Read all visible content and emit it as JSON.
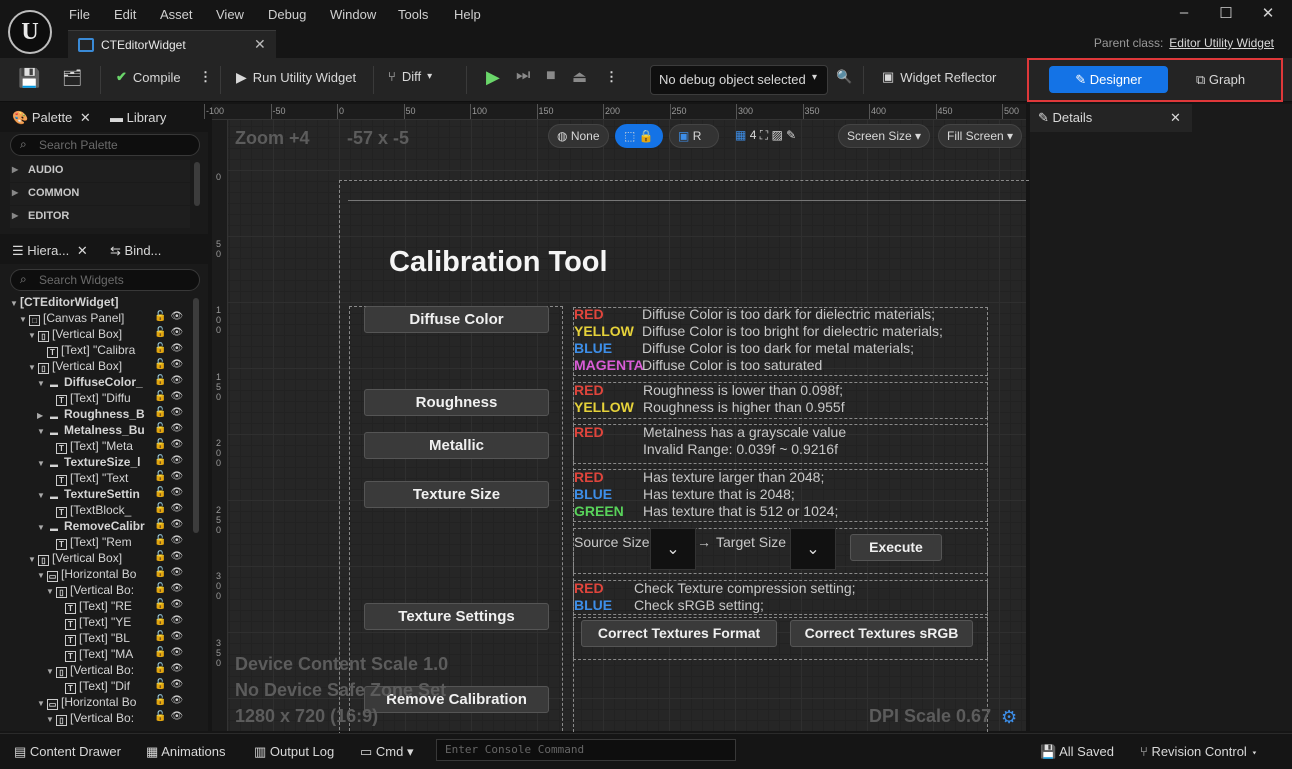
{
  "menu": [
    "File",
    "Edit",
    "Asset",
    "View",
    "Debug",
    "Window",
    "Tools",
    "Help"
  ],
  "tab": {
    "title": "CTEditorWidget"
  },
  "parent_class": {
    "label": "Parent class:",
    "value": "Editor Utility Widget"
  },
  "toolbar": {
    "compile": "Compile",
    "run": "Run Utility Widget",
    "diff": "Diff",
    "debug_object": "No debug object selected",
    "widget_reflector": "Widget Reflector",
    "designer": "Designer",
    "graph": "Graph"
  },
  "palette": {
    "tab": "Palette",
    "library_tab": "Library",
    "search_placeholder": "Search Palette",
    "categories": [
      "AUDIO",
      "COMMON",
      "EDITOR"
    ]
  },
  "hierarchy": {
    "tab": "Hiera...",
    "bind_tab": "Bind...",
    "search_placeholder": "Search Widgets",
    "rows": [
      "[CTEditorWidget]",
      "[Canvas Panel]",
      "[Vertical Box]",
      "[Text] \"Calibra",
      "[Vertical Box]",
      "DiffuseColor_",
      "[Text] \"Diffu",
      "Roughness_B",
      "Metalness_Bu",
      "[Text] \"Meta",
      "TextureSize_l",
      "[Text] \"Text",
      "TextureSettin",
      "[TextBlock_",
      "RemoveCalibr",
      "[Text] \"Rem",
      "[Vertical Box]",
      "[Horizontal Bo",
      "[Vertical Bo:",
      "[Text] \"RE",
      "[Text] \"YE",
      "[Text] \"BL",
      "[Text] \"MA",
      "[Vertical Bo:",
      "[Text] \"Dif",
      "[Horizontal Bo",
      "[Vertical Bo:"
    ]
  },
  "viewport": {
    "zoom": "Zoom +4",
    "coords": "-57 x -5",
    "none_btn": "None",
    "r_btn": "R",
    "grid_num": "4",
    "screen_size": "Screen Size",
    "fill_screen": "Fill Screen",
    "device_scale": "Device Content Scale 1.0",
    "safe_zone": "No Device Safe Zone Set",
    "resolution": "1280 x 720 (16:9)",
    "dpi": "DPI Scale 0.67",
    "ruler_top": [
      "-100",
      "-50",
      "0",
      "50",
      "100",
      "150",
      "200",
      "250",
      "300",
      "350",
      "400",
      "450",
      "500"
    ],
    "ruler_left": [
      [
        "0"
      ],
      [
        "5",
        "0"
      ],
      [
        "1",
        "0",
        "0"
      ],
      [
        "1",
        "5",
        "0"
      ],
      [
        "2",
        "0",
        "0"
      ],
      [
        "2",
        "5",
        "0"
      ],
      [
        "3",
        "0",
        "0"
      ],
      [
        "3",
        "5",
        "0"
      ]
    ]
  },
  "widget": {
    "title": "Calibration Tool",
    "buttons": {
      "diffuse": "Diffuse Color",
      "roughness": "Roughness",
      "metallic": "Metallic",
      "texture_size": "Texture Size",
      "texture_settings": "Texture Settings",
      "remove": "Remove Calibration"
    },
    "diffuse": {
      "labels": [
        "RED",
        "YELLOW",
        "BLUE",
        "MAGENTA"
      ],
      "desc": [
        "Diffuse Color is too dark for dielectric materials;",
        "Diffuse Color is too bright for dielectric materials;",
        "Diffuse Color is too dark for metal materials;",
        "Diffuse Color is too saturated"
      ]
    },
    "roughness": {
      "labels": [
        "RED",
        "YELLOW"
      ],
      "desc": [
        "Roughness is lower than 0.098f;",
        "Roughness is higher than 0.955f"
      ]
    },
    "metallic": {
      "labels": [
        "RED"
      ],
      "desc": [
        "Metalness has a grayscale value",
        "Invalid Range: 0.039f ~ 0.9216f"
      ]
    },
    "texsize": {
      "labels": [
        "RED",
        "BLUE",
        "GREEN"
      ],
      "desc": [
        "Has texture larger than 2048;",
        "Has texture that is 2048;",
        "Has texture that is 512 or 1024;"
      ],
      "source": "Source Size",
      "arrow": "→",
      "target": "Target Size",
      "execute": "Execute"
    },
    "texsettings": {
      "labels": [
        "RED",
        "BLUE"
      ],
      "desc": [
        "Check Texture compression setting;",
        "Check sRGB setting;"
      ],
      "btn_format": "Correct Textures Format",
      "btn_srgb": "Correct Textures sRGB"
    }
  },
  "details": {
    "tab": "Details"
  },
  "status": {
    "content_drawer": "Content Drawer",
    "animations": "Animations",
    "output_log": "Output Log",
    "cmd": "Cmd",
    "console_placeholder": "Enter Console Command",
    "all_saved": "All Saved",
    "revision": "Revision Control"
  },
  "colors": {
    "red": "#e0453c",
    "yellow": "#e6d23a",
    "blue": "#3d8ee8",
    "magenta": "#d95cd6",
    "green": "#58d25a",
    "accent": "#1473e6",
    "highlight": "#e0383a"
  }
}
